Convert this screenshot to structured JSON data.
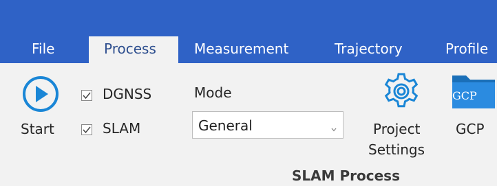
{
  "tabs": {
    "file": "File",
    "process": "Process",
    "measurement": "Measurement",
    "trajectory": "Trajectory",
    "profile": "Profile"
  },
  "ribbon": {
    "start_label": "Start",
    "dgnss_label": "DGNSS",
    "dgnss_checked": true,
    "slam_label": "SLAM",
    "slam_checked": true,
    "mode_label": "Mode",
    "mode_value": "General",
    "project_label": "Project",
    "settings_label": "Settings",
    "gcp_label": "GCP",
    "gcp_icon_text": "GCP",
    "group_label": "SLAM Process"
  },
  "colors": {
    "title_bar": "#2f62c6",
    "ribbon_bg": "#f2f2f2",
    "accent_blue": "#1a86d6"
  },
  "icons": {
    "start": "play-circle-icon",
    "project_settings": "gear-icon",
    "gcp": "folder-icon"
  }
}
